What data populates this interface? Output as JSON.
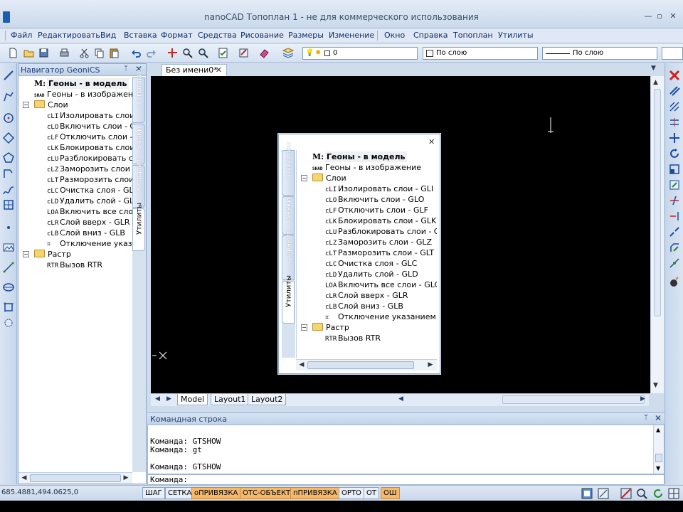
{
  "window": {
    "title": "nanoCAD Топоплан 1 - не для коммерческого использования",
    "minimize": "—",
    "restore": "▫",
    "close": "✕"
  },
  "menu": {
    "items": [
      "Файл",
      "Редактировать",
      "Вид",
      "Вставка",
      "Формат",
      "Средства",
      "Рисование",
      "Размеры",
      "Изменение",
      "Окно",
      "Справка",
      "Топоплан",
      "Утилиты"
    ]
  },
  "toolbar": {
    "layer_combo": "0",
    "color_combo": "По слою",
    "linetype_combo": "По слою"
  },
  "navigator": {
    "title": "Навигатор GeoniCS",
    "pin": "ᛘ",
    "close": "✕",
    "tabs": [
      "Топоплан",
      "Знаки",
      "Алфавит",
      "Утилиты"
    ],
    "tree_truncated": [
      {
        "code": "M:",
        "label": "Геоны - в модель",
        "bold": true
      },
      {
        "code": "SHAD",
        "label": "Геоны - в изображение"
      },
      {
        "expander": "−",
        "label": "Слои",
        "folder": true
      },
      {
        "code": "cLI",
        "label": "Изолировать слои - G"
      },
      {
        "code": "cLO",
        "label": "Включить слои - GLO"
      },
      {
        "code": "cLF",
        "label": "Отключить слои - GL"
      },
      {
        "code": "cLK",
        "label": "Блокировать слои - G"
      },
      {
        "code": "cLU",
        "label": "Разблокировать сло"
      },
      {
        "code": "cLZ",
        "label": "Заморозить слои - G"
      },
      {
        "code": "cLT",
        "label": "Разморозить слои - G"
      },
      {
        "code": "cLC",
        "label": "Очистка слоя - GLC"
      },
      {
        "code": "cLD",
        "label": "Удалить слой - GLD"
      },
      {
        "code": "LOA",
        "label": "Включить все слои -"
      },
      {
        "code": "cLR",
        "label": "Слой вверх - GLR"
      },
      {
        "code": "cLB",
        "label": "Слой вниз - GLB"
      },
      {
        "code": "⌗",
        "label": "Отключение указани"
      },
      {
        "expander": "−",
        "label": "Растр",
        "folder": true
      },
      {
        "code": "RTR",
        "label": "Вызов RTR"
      }
    ],
    "tree_full": [
      {
        "code": "M:",
        "label": "Геоны - в модель",
        "bold": true
      },
      {
        "code": "SHAD",
        "label": "Геоны - в изображение"
      },
      {
        "expander": "−",
        "label": "Слои",
        "folder": true
      },
      {
        "code": "cLI",
        "label": "Изолировать слои - GLI"
      },
      {
        "code": "cLO",
        "label": "Включить слои - GLO"
      },
      {
        "code": "cLF",
        "label": "Отключить слои - GLF"
      },
      {
        "code": "cLK",
        "label": "Блокировать слои - GLK"
      },
      {
        "code": "cLU",
        "label": "Разблокировать слои - GLU"
      },
      {
        "code": "cLZ",
        "label": "Заморозить слои - GLZ"
      },
      {
        "code": "cLT",
        "label": "Разморозить слои - GLT"
      },
      {
        "code": "cLC",
        "label": "Очистка слоя - GLC"
      },
      {
        "code": "cLD",
        "label": "Удалить слой - GLD"
      },
      {
        "code": "LOA",
        "label": "Включить все слои - GLOA"
      },
      {
        "code": "cLR",
        "label": "Слой вверх - GLR"
      },
      {
        "code": "cLB",
        "label": "Слой вниз - GLB"
      },
      {
        "code": "⌗",
        "label": "Отключение указанием на об"
      },
      {
        "expander": "−",
        "label": "Растр",
        "folder": true
      },
      {
        "code": "RTR",
        "label": "Вызов RTR"
      }
    ]
  },
  "document": {
    "tab_label": "Без имени0*",
    "tab_close": "✕",
    "layout_tabs": [
      "Model",
      "Layout1",
      "Layout2"
    ]
  },
  "floating": {
    "close": "✕"
  },
  "command": {
    "title": "Командная строка",
    "pin": "ᛘ",
    "close": "✕",
    "lines": [
      "Команда: GTSHOW",
      "Команда: gt",
      "",
      "Команда: GTSHOW"
    ],
    "prompt": "Команда:"
  },
  "status": {
    "coords": "685.4881,494.0625,0",
    "buttons": [
      {
        "label": "ШАГ",
        "on": false
      },
      {
        "label": "СЕТКА",
        "on": false
      },
      {
        "label": "оПРИВЯЗКА",
        "on": true
      },
      {
        "label": "ОТС-ОБЪЕКТ",
        "on": true
      },
      {
        "label": "пПРИВЯЗКА",
        "on": true
      },
      {
        "label": "ОРТО",
        "on": false
      },
      {
        "label": "ОТ",
        "on": false
      },
      {
        "label": "ОШ",
        "on": true
      }
    ]
  },
  "colors": {
    "accent": "#1a5fb4",
    "status_on": "#f5b96c",
    "canvas": "#000000"
  }
}
